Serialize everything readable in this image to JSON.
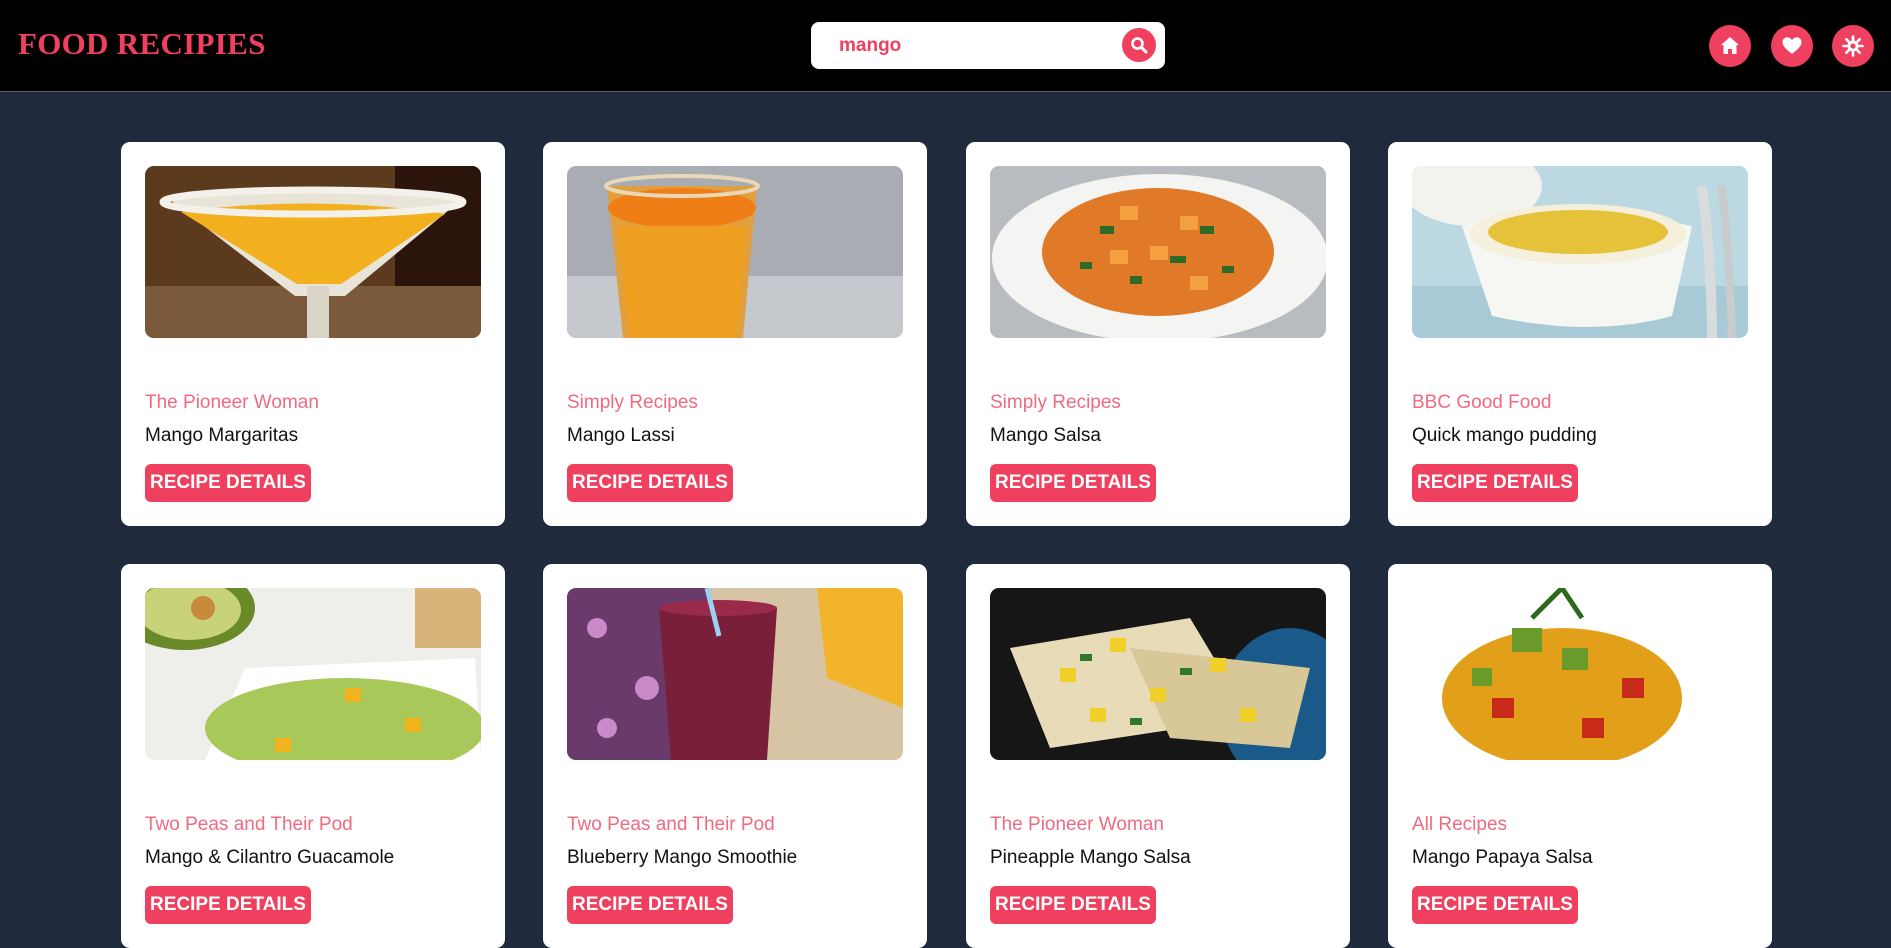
{
  "app": {
    "title": "FOOD RECIPIES"
  },
  "search": {
    "value": "mango"
  },
  "nav": {
    "icons": [
      "home-icon",
      "heart-icon",
      "settings-icon"
    ]
  },
  "colors": {
    "accent": "#f0405f",
    "background": "#1f2a3c",
    "header": "#000000"
  },
  "recipes": [
    {
      "source": "The Pioneer Woman",
      "title": "Mango Margaritas",
      "button": "RECIPE DETAILS"
    },
    {
      "source": "Simply Recipes",
      "title": "Mango Lassi",
      "button": "RECIPE DETAILS"
    },
    {
      "source": "Simply Recipes",
      "title": "Mango Salsa",
      "button": "RECIPE DETAILS"
    },
    {
      "source": "BBC Good Food",
      "title": "Quick mango pudding",
      "button": "RECIPE DETAILS"
    },
    {
      "source": "Two Peas and Their Pod",
      "title": "Mango & Cilantro Guacamole",
      "button": "RECIPE DETAILS"
    },
    {
      "source": "Two Peas and Their Pod",
      "title": "Blueberry Mango Smoothie",
      "button": "RECIPE DETAILS"
    },
    {
      "source": "The Pioneer Woman",
      "title": "Pineapple Mango Salsa",
      "button": "RECIPE DETAILS"
    },
    {
      "source": "All Recipes",
      "title": "Mango Papaya Salsa",
      "button": "RECIPE DETAILS"
    }
  ]
}
